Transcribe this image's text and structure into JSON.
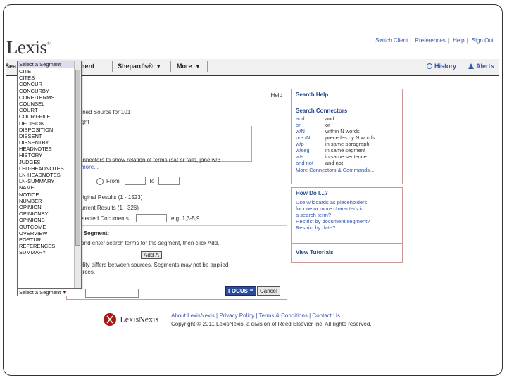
{
  "header": {
    "logo_text": "Lexis",
    "logo_mark": "®",
    "links": [
      "Switch Client",
      "Preferences",
      "Help",
      "Sign Out"
    ]
  },
  "nav": {
    "search_partial": "Sea",
    "document_partial": "ument",
    "shepards": "Shepard's®",
    "more": "More",
    "history": "History",
    "alerts": "Alerts"
  },
  "form": {
    "help": "Help",
    "combined_source": "bined Source for 101",
    "right_text": "right",
    "connectors_hint": "connectors to show relation of terms (sat or falls, jane w/3",
    "more_link": "more...",
    "from_label": "From",
    "to_label": "To",
    "original_results": "Original Results (1 - 1523)",
    "current_results": "Current Results (1 - 326)",
    "selected_docs": "Selected Documents",
    "selected_docs_example": "e.g. 1,3-5,9",
    "segment_heading": "nt Segment:",
    "segment_instruction": "it and enter search terms for the segment, then click Add.",
    "segment_select_value": "Select a Segment",
    "add_button": "Add",
    "note": "Note: Segment availability differs between sources. Segments may not be applied",
    "note2": "consistently across sources.",
    "focus_button": "FOCUS™",
    "cancel_button": "Cancel"
  },
  "dropdown": {
    "header": "Select a Segment",
    "items": [
      "CITE",
      "CITES",
      "CONCUR",
      "CONCURBY",
      "CORE-TERMS",
      "COUNSEL",
      "COURT",
      "COURT-FILE",
      "DECISION",
      "DISPOSITION",
      "DISSENT",
      "DISSENTBY",
      "HEADNOTES",
      "HISTORY",
      "JUDGES",
      "LED-HEADNOTES",
      "LN-HEADNOTES",
      "LN-SUMMARY",
      "NAME",
      "NOTICE",
      "NUMBER",
      "OPINION",
      "OPINIONBY",
      "OPINIONS",
      "OUTCOME",
      "OVERVIEW",
      "POSTUR",
      "REFERENCES",
      "SUMMARY"
    ]
  },
  "search_help": {
    "title": "Search Help",
    "connectors_title": "Search Connectors",
    "connectors": [
      {
        "k": "and",
        "v": "and"
      },
      {
        "k": "or",
        "v": "or"
      },
      {
        "k": "w/N",
        "v": "within N words"
      },
      {
        "k": "pre /N",
        "v": "precedes by N words"
      },
      {
        "k": "w/p",
        "v": "in same paragraph"
      },
      {
        "k": "w/seg",
        "v": "in same segment"
      },
      {
        "k": "w/s",
        "v": "in same sentence"
      },
      {
        "k": "and not",
        "v": "and not"
      }
    ],
    "more_link": "More Connectors & Commands..."
  },
  "how_do_i": {
    "title": "How Do I...?",
    "links": [
      "Use wildcards as placeholders",
      "for one or more characters in",
      "a search term?",
      "Restrict by document segment?",
      "Restrict by date?"
    ]
  },
  "tutorials": {
    "label": "View Tutorials"
  },
  "footer": {
    "logo_text": "LexisNexis",
    "links": [
      "About LexisNexis",
      "Privacy Policy",
      "Terms & Conditions",
      "Contact Us"
    ],
    "copyright": "Copyright © 2011 LexisNexis, a division of Reed Elsevier Inc. All rights reserved."
  },
  "colors": {
    "accent": "#7a1515",
    "link": "#3355aa",
    "focus": "#2a4a9a"
  }
}
